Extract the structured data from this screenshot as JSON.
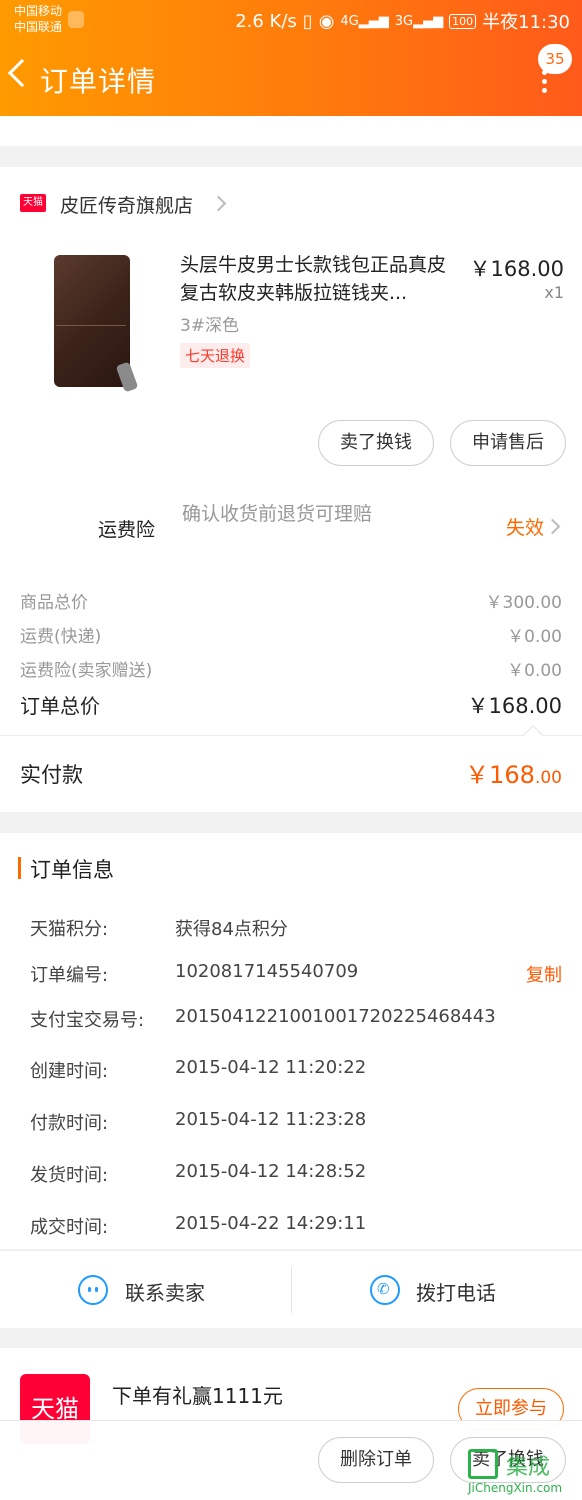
{
  "status_bar": {
    "carrier1": "中国移动",
    "carrier2": "中国联通",
    "speed": "2.6 K/s",
    "sig_4g": "4G",
    "sig_3g": "3G",
    "battery": "100",
    "time": "半夜11:30"
  },
  "header": {
    "title": "订单详情",
    "badge_count": "35"
  },
  "store": {
    "tag": "天猫",
    "name": "皮匠传奇旗舰店"
  },
  "product": {
    "title": "头层牛皮男士长款钱包正品真皮复古软皮夹韩版拉链钱夹...",
    "price": "￥168.00",
    "qty": "x1",
    "sku": "3#深色",
    "return_tag": "七天退换"
  },
  "actions": {
    "sell": "卖了换钱",
    "after_sale": "申请售后"
  },
  "insurance": {
    "label": "运费险",
    "desc": "确认收货前退货可理赔",
    "status": "失效"
  },
  "fees": [
    {
      "label": "商品总价",
      "value": "￥300.00"
    },
    {
      "label": "运费(快递)",
      "value": "￥0.00"
    },
    {
      "label": "运费险(卖家赠送)",
      "value": "￥0.00"
    }
  ],
  "totals": {
    "order_total_label": "订单总价",
    "order_total_value": "￥168.00",
    "paid_label": "实付款",
    "paid_big": "￥168",
    "paid_small": ".00"
  },
  "order_info": {
    "title": "订单信息",
    "rows": [
      {
        "label": "天猫积分:",
        "value": "获得84点积分"
      },
      {
        "label": "订单编号:",
        "value": "1020817145540709"
      },
      {
        "label": "支付宝交易号:",
        "value": "2015041221001001720225468443"
      },
      {
        "label": "创建时间:",
        "value": "2015-04-12 11:20:22"
      },
      {
        "label": "付款时间:",
        "value": "2015-04-12 11:23:28"
      },
      {
        "label": "发货时间:",
        "value": "2015-04-12 14:28:52"
      },
      {
        "label": "成交时间:",
        "value": "2015-04-22 14:29:11"
      }
    ],
    "copy": "复制"
  },
  "contact": {
    "seller": "联系卖家",
    "phone": "拨打电话"
  },
  "promo": {
    "logo_text": "天猫",
    "text": "下单有礼赢1111元",
    "button": "立即参与"
  },
  "bottom": {
    "delete": "删除订单",
    "sell": "卖了换钱"
  },
  "watermark": {
    "text": "集成",
    "url": "JiChengXin.com"
  }
}
